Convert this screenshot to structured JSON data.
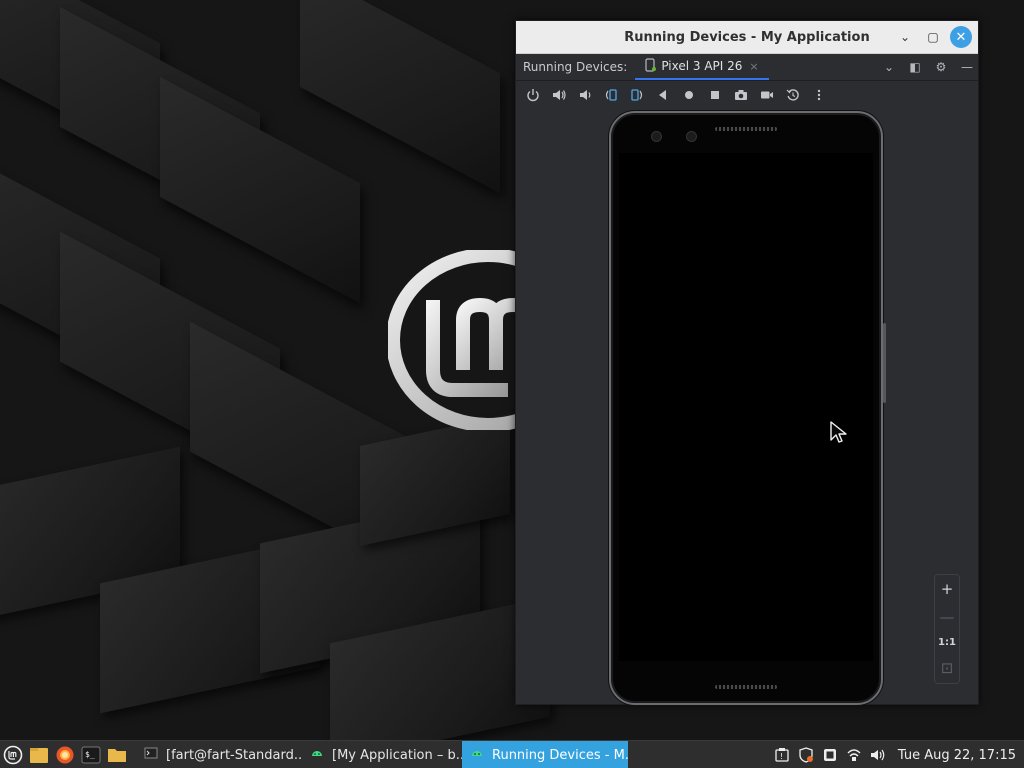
{
  "window": {
    "title": "Running Devices - My Application",
    "controls": {
      "minimize": "⌄",
      "maximize": "▢",
      "close": "✕"
    }
  },
  "tabbar": {
    "label": "Running Devices:",
    "tab_name": "Pixel 3 API 26",
    "tab_close": "×",
    "dropdown": "⌄",
    "layout": "◧",
    "settings": "⚙",
    "minimize": "—"
  },
  "toolbar": {
    "icons": [
      "power-icon",
      "volume-up-icon",
      "volume-down-icon",
      "rotate-left-icon",
      "rotate-right-icon",
      "back-icon",
      "home-icon",
      "overview-icon",
      "screenshot-icon",
      "screen-record-icon",
      "reset-icon",
      "more-options-icon"
    ]
  },
  "zoom": {
    "zoom_in": "+",
    "zoom_out": "—",
    "actual_size": "1:1",
    "fit": "⊡"
  },
  "taskbar": {
    "tasks": [
      {
        "label": "[fart@fart-Standard...",
        "icon": "terminal-icon"
      },
      {
        "label": "[My Application – b...",
        "icon": "android-studio-icon"
      },
      {
        "label": "Running Devices - M...",
        "icon": "android-icon"
      }
    ],
    "launcher_icons": [
      "mint-menu-icon",
      "files-icon",
      "firefox-icon",
      "terminal-icon",
      "folder-icon"
    ],
    "tray_icons": [
      "update-manager-icon",
      "shield-icon",
      "clipboard-icon",
      "network-icon",
      "volume-icon"
    ],
    "clock": "Tue Aug 22, 17:15"
  },
  "colors": {
    "accent": "#35a2e0",
    "ide_background": "#2b2d30",
    "tab_underline": "#3574f0"
  }
}
